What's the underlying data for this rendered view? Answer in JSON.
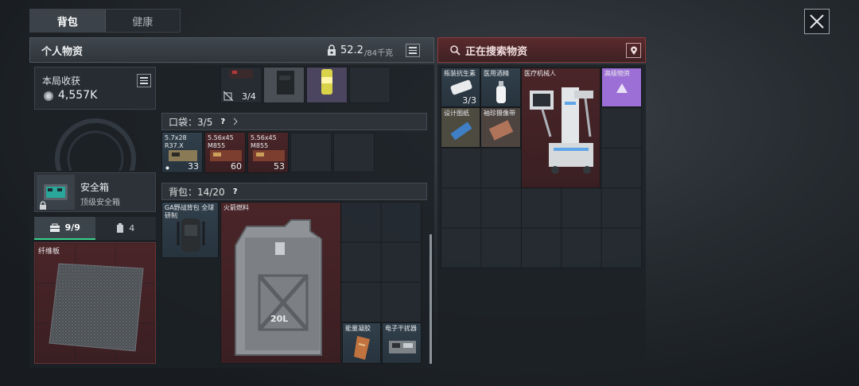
{
  "tabs": [
    "背包",
    "健康"
  ],
  "left_header": {
    "title": "个人物资",
    "weight_current": "52.2",
    "weight_max": "/84千克"
  },
  "right_header": {
    "title": "正在搜索物资"
  },
  "session": {
    "label": "本局收获",
    "value": "4,557K"
  },
  "safe_box": {
    "name": "安全箱",
    "desc": "顶级安全箱"
  },
  "equip_tabs": [
    {
      "icon": "toolbox-icon",
      "value": "9/9"
    },
    {
      "icon": "canister-icon",
      "value": "4"
    }
  ],
  "armor_slot": {
    "label": "纤维板"
  },
  "top_row": {
    "count": "3/4"
  },
  "pocket": {
    "label": "口袋：",
    "value": "3/5",
    "help": "?",
    "items": [
      {
        "name": "5.7x28 R37.X",
        "count": "33"
      },
      {
        "name": "5.56x45 M855",
        "count": "60"
      },
      {
        "name": "5.56x45 M855",
        "count": "53"
      }
    ]
  },
  "backpack": {
    "label": "背包：",
    "value": "14/20",
    "help": "?",
    "items": [
      {
        "name": "GA野战背包 全球研制"
      },
      {
        "name": "火箭燃料",
        "can_text": "20L"
      },
      {
        "name": "能量凝胶"
      },
      {
        "name": "电子干扰器"
      }
    ]
  },
  "search_items": [
    {
      "name": "瓶装抗生素",
      "count": "3/3"
    },
    {
      "name": "医用酒精"
    },
    {
      "name": "医疗机械人"
    },
    {
      "name": "高级物资"
    },
    {
      "name": "设计图纸"
    },
    {
      "name": "袖珍摄像带"
    }
  ],
  "colors": {
    "rare_red": "#4a2528",
    "common_blue": "#31404c",
    "purple": "#9c6fd6",
    "accent_red": "#8d3a3d"
  }
}
